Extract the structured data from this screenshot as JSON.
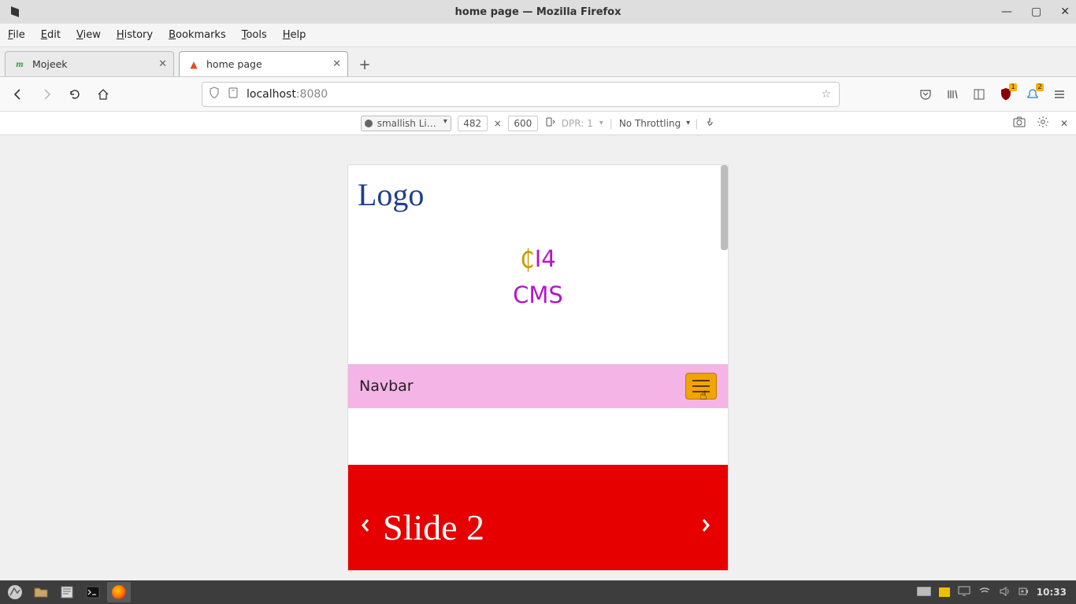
{
  "window": {
    "title": "home page — Mozilla Firefox",
    "menus": [
      "File",
      "Edit",
      "View",
      "History",
      "Bookmarks",
      "Tools",
      "Help"
    ]
  },
  "tabs": {
    "items": [
      {
        "label": "Mojeek",
        "active": false
      },
      {
        "label": "home page",
        "active": true
      }
    ]
  },
  "url": {
    "domain": "localhost",
    "port": ":8080"
  },
  "toolbar_badges": {
    "ublock": "1",
    "bell": "2"
  },
  "rdm": {
    "device": "smallish Li…",
    "width": "482",
    "height": "600",
    "dpr": "DPR: 1",
    "throttling": "No Throttling"
  },
  "page": {
    "logo": "Logo",
    "brand_line1": "I4",
    "brand_line2": "CMS",
    "navbar_label": "Navbar",
    "slide_label": "Slide 2"
  },
  "system": {
    "clock": "10:33"
  }
}
